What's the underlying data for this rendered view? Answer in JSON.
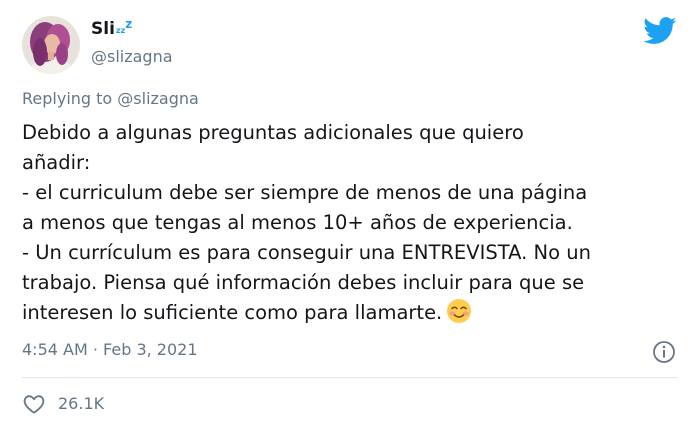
{
  "user": {
    "display_name": "Sli",
    "name_suffix_small": "z",
    "name_suffix_big": "z",
    "handle": "@slizagna"
  },
  "reply": {
    "prefix": "Replying to ",
    "target": "@slizagna"
  },
  "tweet": {
    "lines": [
      "Debido a algunas preguntas adicionales que quiero",
      "añadir:",
      "- el curriculum debe ser siempre de menos de una página",
      "a menos que tengas al menos 10+ años de experiencia.",
      "- Un currículum es para conseguir una ENTREVISTA. No un",
      "trabajo. Piensa qué información debes incluir para que se",
      "interesen lo suficiente como para llamarte."
    ],
    "emoji_icon": "smiling-face-with-blush-icon",
    "timestamp": "4:54 AM · Feb 3, 2021",
    "likes": "26.1K"
  },
  "icons": {
    "logo": "twitter-bird-icon",
    "info": "info-icon",
    "like": "heart-icon"
  },
  "colors": {
    "brand": "#1da1f2",
    "secondary_text": "#657786",
    "primary_text": "#14171a",
    "divider": "#e1e8ed"
  }
}
